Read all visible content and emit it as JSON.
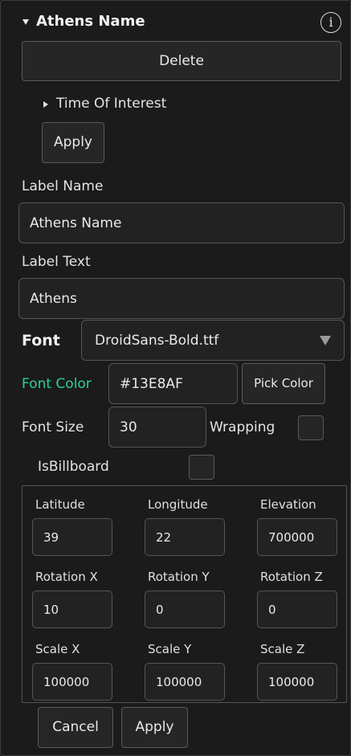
{
  "header": {
    "title": "Athens Name",
    "info_glyph": "i"
  },
  "delete_button": "Delete",
  "time_of_interest": {
    "label": "Time Of Interest",
    "apply_label": "Apply"
  },
  "label_name": {
    "label": "Label Name",
    "value": "Athens Name"
  },
  "label_text": {
    "label": "Label Text",
    "value": "Athens"
  },
  "font": {
    "label": "Font",
    "selected": "DroidSans-Bold.ttf"
  },
  "font_color": {
    "label": "Font Color",
    "value": "#13E8AF",
    "pick_label": "Pick Color",
    "label_color": "#2ccf9a"
  },
  "font_size": {
    "label": "Font Size",
    "value": "30"
  },
  "wrapping": {
    "label": "Wrapping",
    "checked": false
  },
  "billboard": {
    "label": "IsBillboard",
    "checked": false
  },
  "transform": {
    "latitude": {
      "label": "Latitude",
      "value": "39"
    },
    "longitude": {
      "label": "Longitude",
      "value": "22"
    },
    "elevation": {
      "label": "Elevation",
      "value": "700000"
    },
    "rotation_x": {
      "label": "Rotation X",
      "value": "10"
    },
    "rotation_y": {
      "label": "Rotation Y",
      "value": "0"
    },
    "rotation_z": {
      "label": "Rotation Z",
      "value": "0"
    },
    "scale_x": {
      "label": "Scale X",
      "value": "100000"
    },
    "scale_y": {
      "label": "Scale Y",
      "value": "100000"
    },
    "scale_z": {
      "label": "Scale Z",
      "value": "100000"
    }
  },
  "footer": {
    "cancel_label": "Cancel",
    "apply_label": "Apply"
  }
}
